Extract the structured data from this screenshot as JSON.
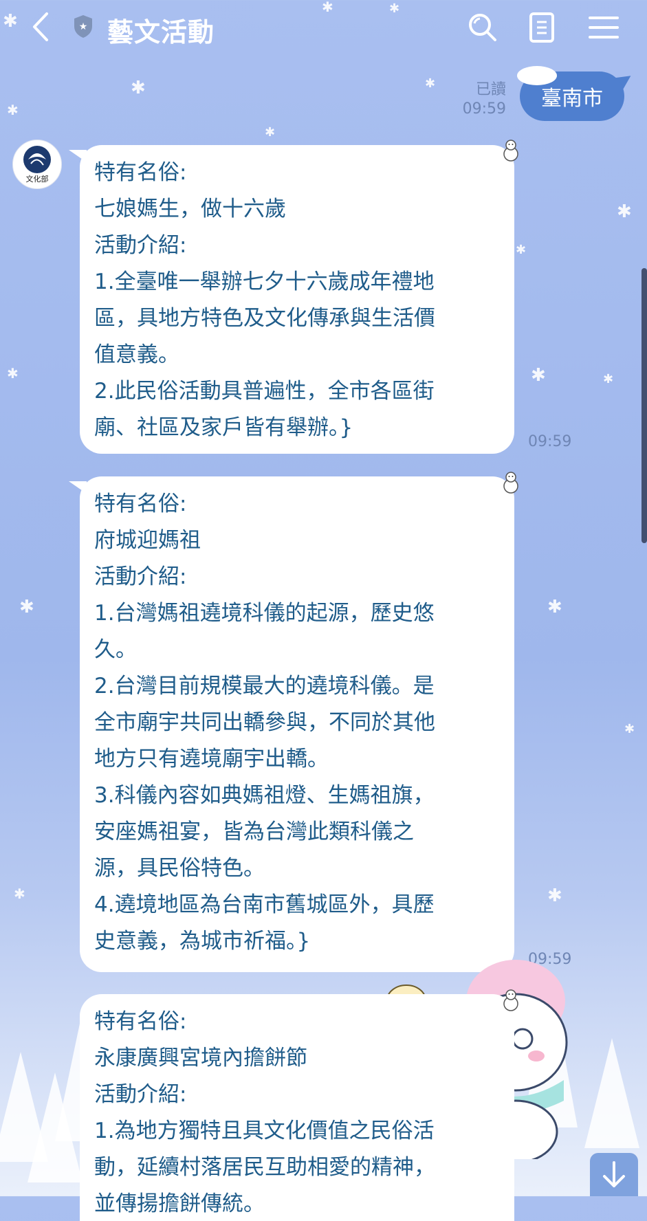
{
  "header": {
    "title": "藝文活動",
    "icons": [
      "back-chevron-icon",
      "official-shield-icon",
      "search-icon",
      "notes-icon",
      "menu-icon"
    ]
  },
  "sent": {
    "text": "臺南市",
    "read_label": "已讀",
    "time": "09:59"
  },
  "received": [
    {
      "lines": [
        "特有名俗:",
        "七娘媽生，做十六歲",
        "活動介紹:",
        "1.全臺唯一舉辦七夕十六歲成年禮地",
        "區，具地方特色及文化傳承與生活價",
        "值意義。",
        "2.此民俗活動具普遍性，全市各區街",
        "廟、社區及家戶皆有舉辦。}"
      ],
      "time": "09:59"
    },
    {
      "lines": [
        "特有名俗:",
        "府城迎媽祖",
        "活動介紹:",
        "1.台灣媽祖遶境科儀的起源，歷史悠",
        "久。",
        "2.台灣目前規模最大的遶境科儀。是",
        "全市廟宇共同出轎參與，不同於其他",
        "地方只有遶境廟宇出轎。",
        "3.科儀內容如典媽祖燈、生媽祖旗，",
        "安座媽祖宴，皆為台灣此類科儀之",
        "源，具民俗特色。",
        "4.遶境地區為台南市舊城區外，具歷",
        "史意義，為城市祈福。}"
      ],
      "time": "09:59"
    },
    {
      "lines": [
        "特有名俗:",
        "永康廣興宮境內擔餅節",
        "活動介紹:",
        "1.為地方獨特且具文化價值之民俗活",
        "動，延續村落居民互助相愛的精神，",
        "並傳揚擔餅傳統。"
      ]
    }
  ],
  "avatar_logo_text": "文化部",
  "colors": {
    "background": "#a9bff0",
    "sent_bubble": "#4f7fcf",
    "received_text": "#1f5c8a",
    "meta_text": "#6f86b5"
  }
}
